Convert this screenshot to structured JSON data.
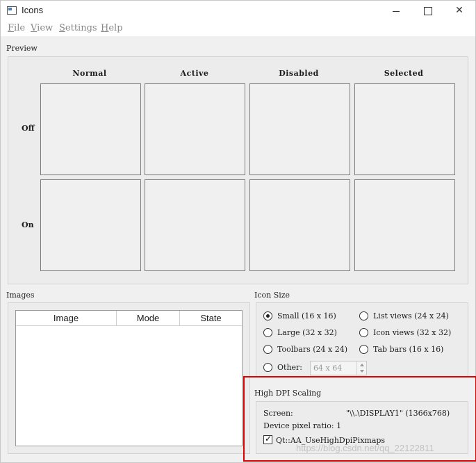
{
  "window": {
    "title": "Icons",
    "controls": {
      "minimize": "",
      "maximize": "",
      "close": "✕"
    }
  },
  "menu": [
    {
      "letter": "F",
      "rest": "ile"
    },
    {
      "letter": "V",
      "rest": "iew"
    },
    {
      "letter": "S",
      "rest": "ettings"
    },
    {
      "letter": "H",
      "rest": "elp"
    }
  ],
  "preview": {
    "label": "Preview",
    "columns": [
      "Normal",
      "Active",
      "Disabled",
      "Selected"
    ],
    "rows": [
      "Off",
      "On"
    ]
  },
  "images": {
    "label": "Images",
    "columns": [
      "Image",
      "Mode",
      "State"
    ]
  },
  "icon_size": {
    "label": "Icon Size",
    "options": [
      {
        "label": "Small (16 x 16)",
        "checked": true
      },
      {
        "label": "List views (24 x 24)",
        "checked": false
      },
      {
        "label": "Large (32 x 32)",
        "checked": false
      },
      {
        "label": "Icon views (32 x 32)",
        "checked": false
      },
      {
        "label": "Toolbars (24 x 24)",
        "checked": false
      },
      {
        "label": "Tab bars (16 x 16)",
        "checked": false
      },
      {
        "label": "Other:",
        "checked": false
      }
    ],
    "other_value": "64 x 64"
  },
  "high_dpi": {
    "label": "High DPI Scaling",
    "screen_label": "Screen:",
    "screen_value": "\"\\\\.\\DISPLAY1\" (1366x768)",
    "ratio_text": "Device pixel ratio: 1",
    "checkbox_label": "Qt::AA_UseHighDpiPixmaps",
    "checkbox_checked": true
  },
  "watermark": "https://blog.csdn.net/qq_22122811",
  "colors": {
    "highlight": "#e00000"
  }
}
